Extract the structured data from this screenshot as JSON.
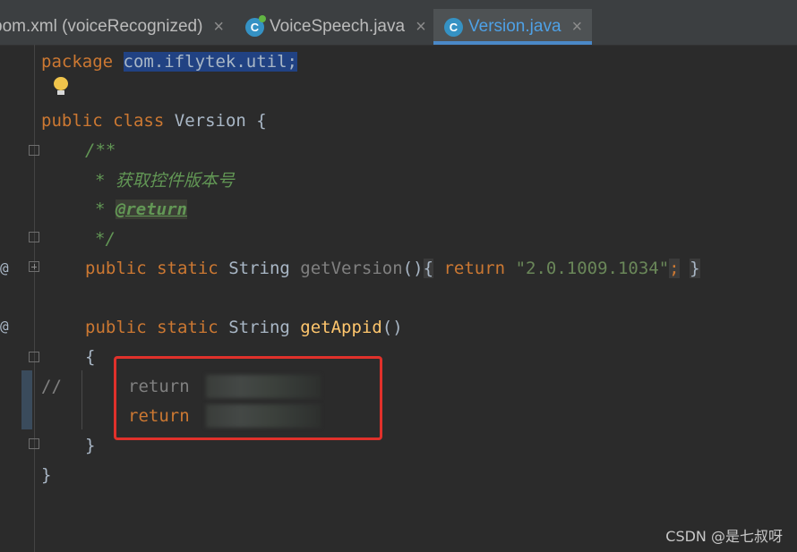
{
  "tabs": [
    {
      "label": "pom.xml (voiceRecognized)",
      "icon": "maven-icon",
      "active": false
    },
    {
      "label": "VoiceSpeech.java",
      "icon": "java-class-icon",
      "active": false
    },
    {
      "label": "Version.java",
      "icon": "java-class-icon",
      "active": true
    }
  ],
  "tab_close_glyph": "×",
  "code": {
    "package_kw": "package",
    "package_name": "com.iflytek.util;",
    "class_decl": {
      "public": "public",
      "class": "class",
      "name": "Version",
      "brace": "{"
    },
    "javadoc": {
      "open": "/**",
      "desc": "* 获取控件版本号",
      "return_star": "*",
      "return_tag": "@return",
      "close": "*/"
    },
    "get_version": {
      "public": "public",
      "static": "static",
      "type": "String",
      "name": "getVersion",
      "parens": "()",
      "open_brace": "{",
      "return_kw": "return",
      "value": "\"2.0.1009.1034\"",
      "semicolon": ";",
      "close_brace": "}"
    },
    "get_appid": {
      "public": "public",
      "static": "static",
      "type": "String",
      "name": "getAppid",
      "parens": "()",
      "open_brace": "{",
      "close_brace": "}"
    },
    "comment_marker": "//",
    "commented_return": "return",
    "active_return": "return",
    "class_close": "}"
  },
  "gutter_markers": {
    "override": "@"
  },
  "watermark": "CSDN @是七叔呀",
  "colors": {
    "keyword": "#cc7832",
    "string": "#6a8759",
    "doc_comment": "#629755",
    "method": "#ffc66d",
    "text": "#a9b7c6",
    "selection": "#214283",
    "annotation_box": "#e0312b"
  }
}
